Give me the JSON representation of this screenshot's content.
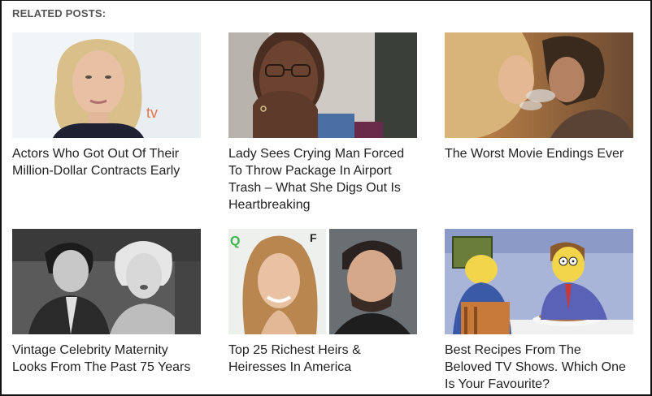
{
  "section": {
    "heading": "RELATED POSTS:"
  },
  "posts": [
    {
      "title": "Actors Who Got Out Of Their Million-Dollar Contracts Early"
    },
    {
      "title": "Lady Sees Crying Man Forced To Throw Package In Airport Trash – What She Digs Out Is Heartbreaking"
    },
    {
      "title": "The Worst Movie Endings Ever"
    },
    {
      "title": "Vintage Celebrity Maternity Looks From The Past 75 Years"
    },
    {
      "title": "Top 25 Richest Heirs & Heiresses In America"
    },
    {
      "title": "Best Recipes From The Beloved TV Shows. Which One Is Your Favourite?"
    }
  ]
}
